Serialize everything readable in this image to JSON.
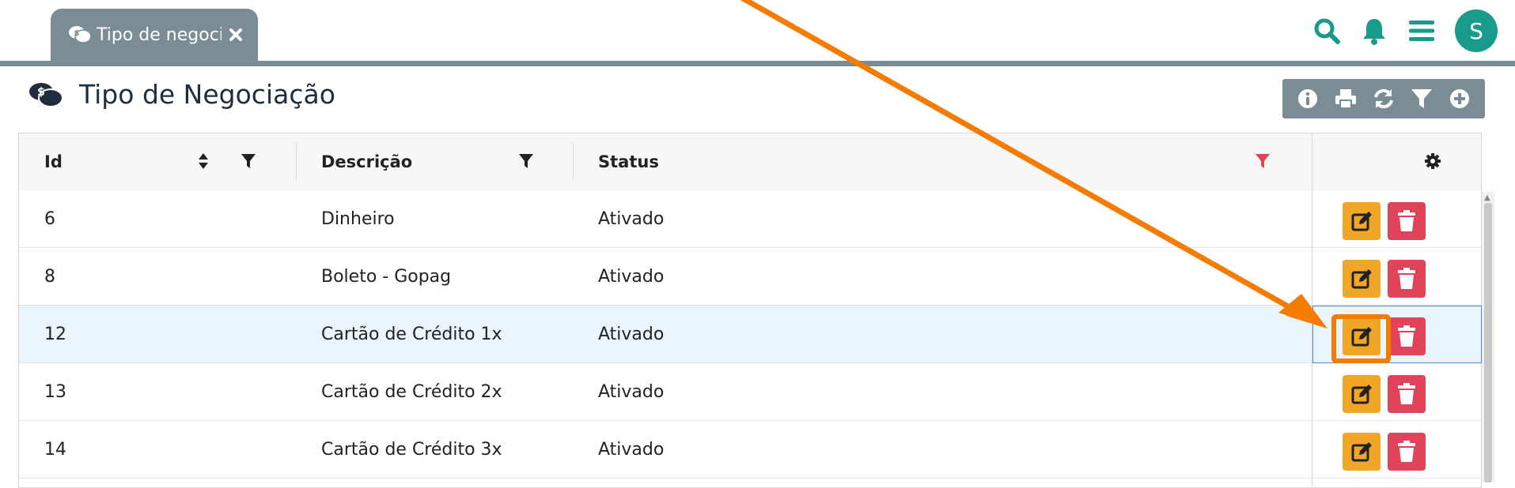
{
  "tab": {
    "label": "Tipo de negocia"
  },
  "page": {
    "title": "Tipo de Negociação"
  },
  "user": {
    "avatar_initial": "S"
  },
  "colors": {
    "teal": "#179c8c",
    "slate": "#7a8c96",
    "edit_button": "#f0a626",
    "delete_button": "#e0435a",
    "annotation": "#f57c00",
    "status_filter_active": "#e0435a"
  },
  "table": {
    "columns": [
      {
        "label": "Id",
        "icons": [
          "sort-icon",
          "filter-icon"
        ]
      },
      {
        "label": "Descrição",
        "icons": [
          "filter-icon"
        ]
      },
      {
        "label": "Status",
        "icons": [
          "filter-icon"
        ]
      },
      {
        "label": "",
        "icons": [
          "gear-icon"
        ]
      }
    ],
    "rows": [
      {
        "id": "6",
        "descricao": "Dinheiro",
        "status": "Ativado"
      },
      {
        "id": "8",
        "descricao": "Boleto - Gopag",
        "status": "Ativado"
      },
      {
        "id": "12",
        "descricao": "Cartão de Crédito 1x",
        "status": "Ativado"
      },
      {
        "id": "13",
        "descricao": "Cartão de Crédito 2x",
        "status": "Ativado"
      },
      {
        "id": "14",
        "descricao": "Cartão de Crédito 3x",
        "status": "Ativado"
      }
    ]
  }
}
